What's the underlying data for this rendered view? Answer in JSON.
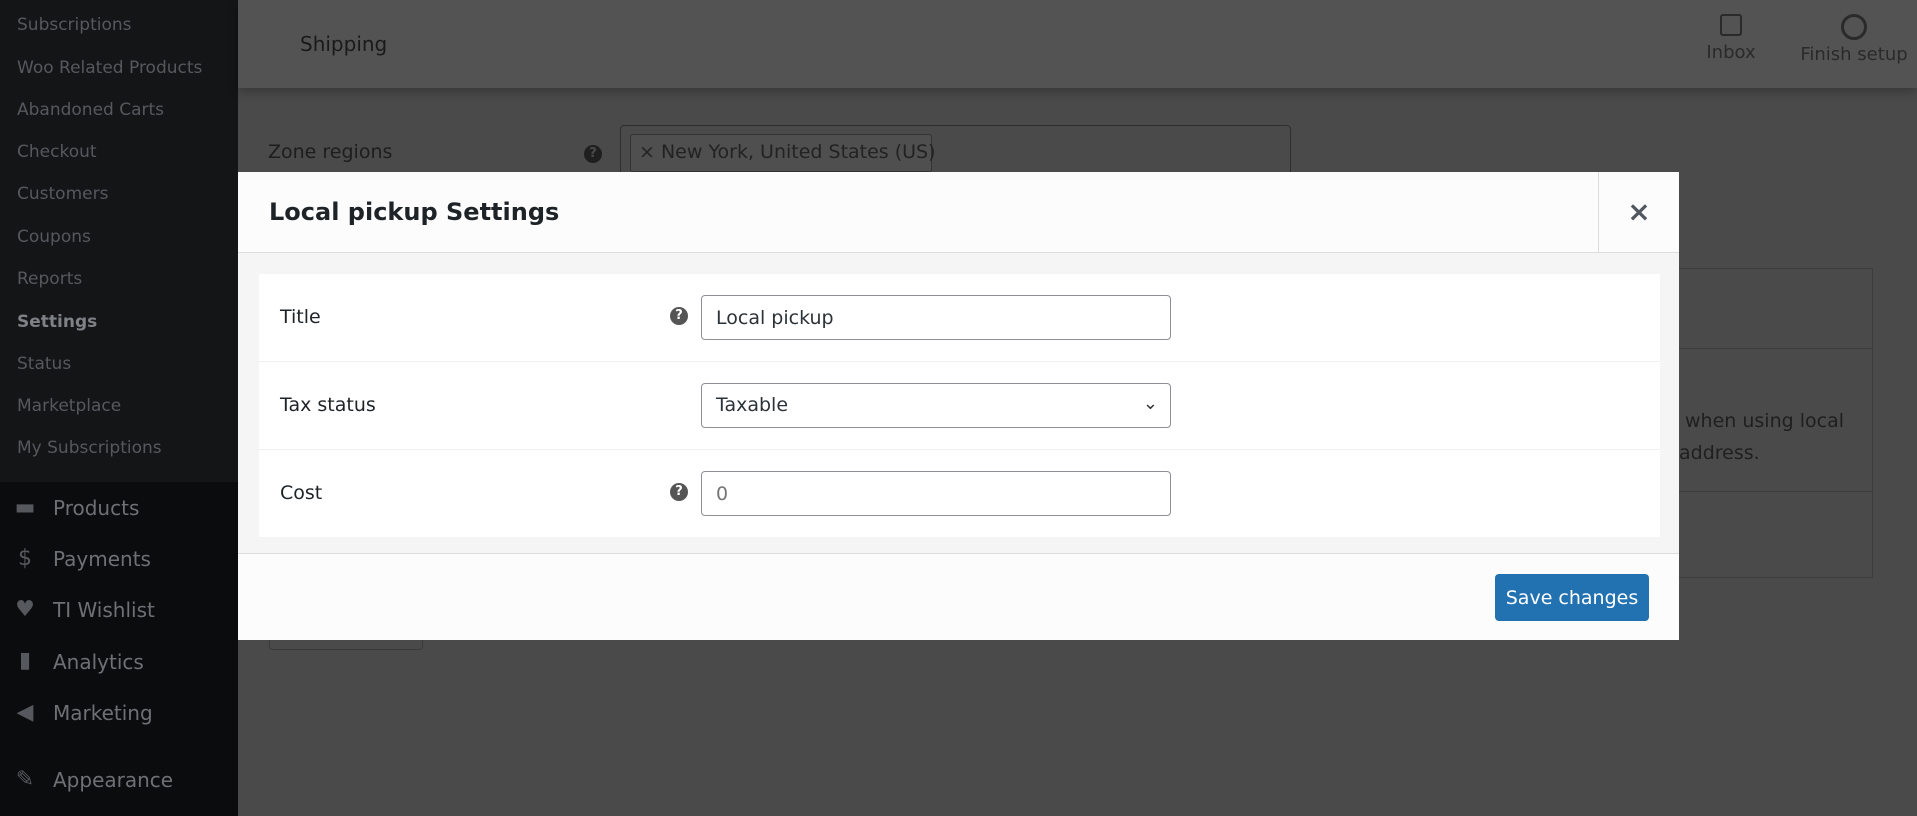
{
  "sidebar": {
    "submenu": [
      "Subscriptions",
      "Woo Related Products",
      "Abandoned Carts",
      "Checkout",
      "Customers",
      "Coupons",
      "Reports",
      "Settings",
      "Status",
      "Marketplace",
      "My Subscriptions"
    ],
    "current": "Settings",
    "menu": [
      {
        "label": "Products",
        "icon": "archive-icon"
      },
      {
        "label": "Payments",
        "icon": "dollar-icon"
      },
      {
        "label": "TI Wishlist",
        "icon": "heart-icon"
      },
      {
        "label": "Analytics",
        "icon": "bar-chart-icon"
      },
      {
        "label": "Marketing",
        "icon": "megaphone-icon"
      },
      {
        "label": "Appearance",
        "icon": "paintbrush-icon"
      }
    ]
  },
  "header": {
    "title": "Shipping",
    "inbox": "Inbox",
    "finish_setup": "Finish setup"
  },
  "background": {
    "zone_regions_label": "Zone regions",
    "zone_tag": "× New York, United States (US)",
    "text_line1": "when using local",
    "text_line2": "address."
  },
  "modal": {
    "title": "Local pickup Settings",
    "close": "×",
    "fields": {
      "title": {
        "label": "Title",
        "value": "Local pickup"
      },
      "tax_status": {
        "label": "Tax status",
        "value": "Taxable"
      },
      "cost": {
        "label": "Cost",
        "placeholder": "0"
      }
    },
    "save_label": "Save changes",
    "accent": "#2271b1"
  }
}
